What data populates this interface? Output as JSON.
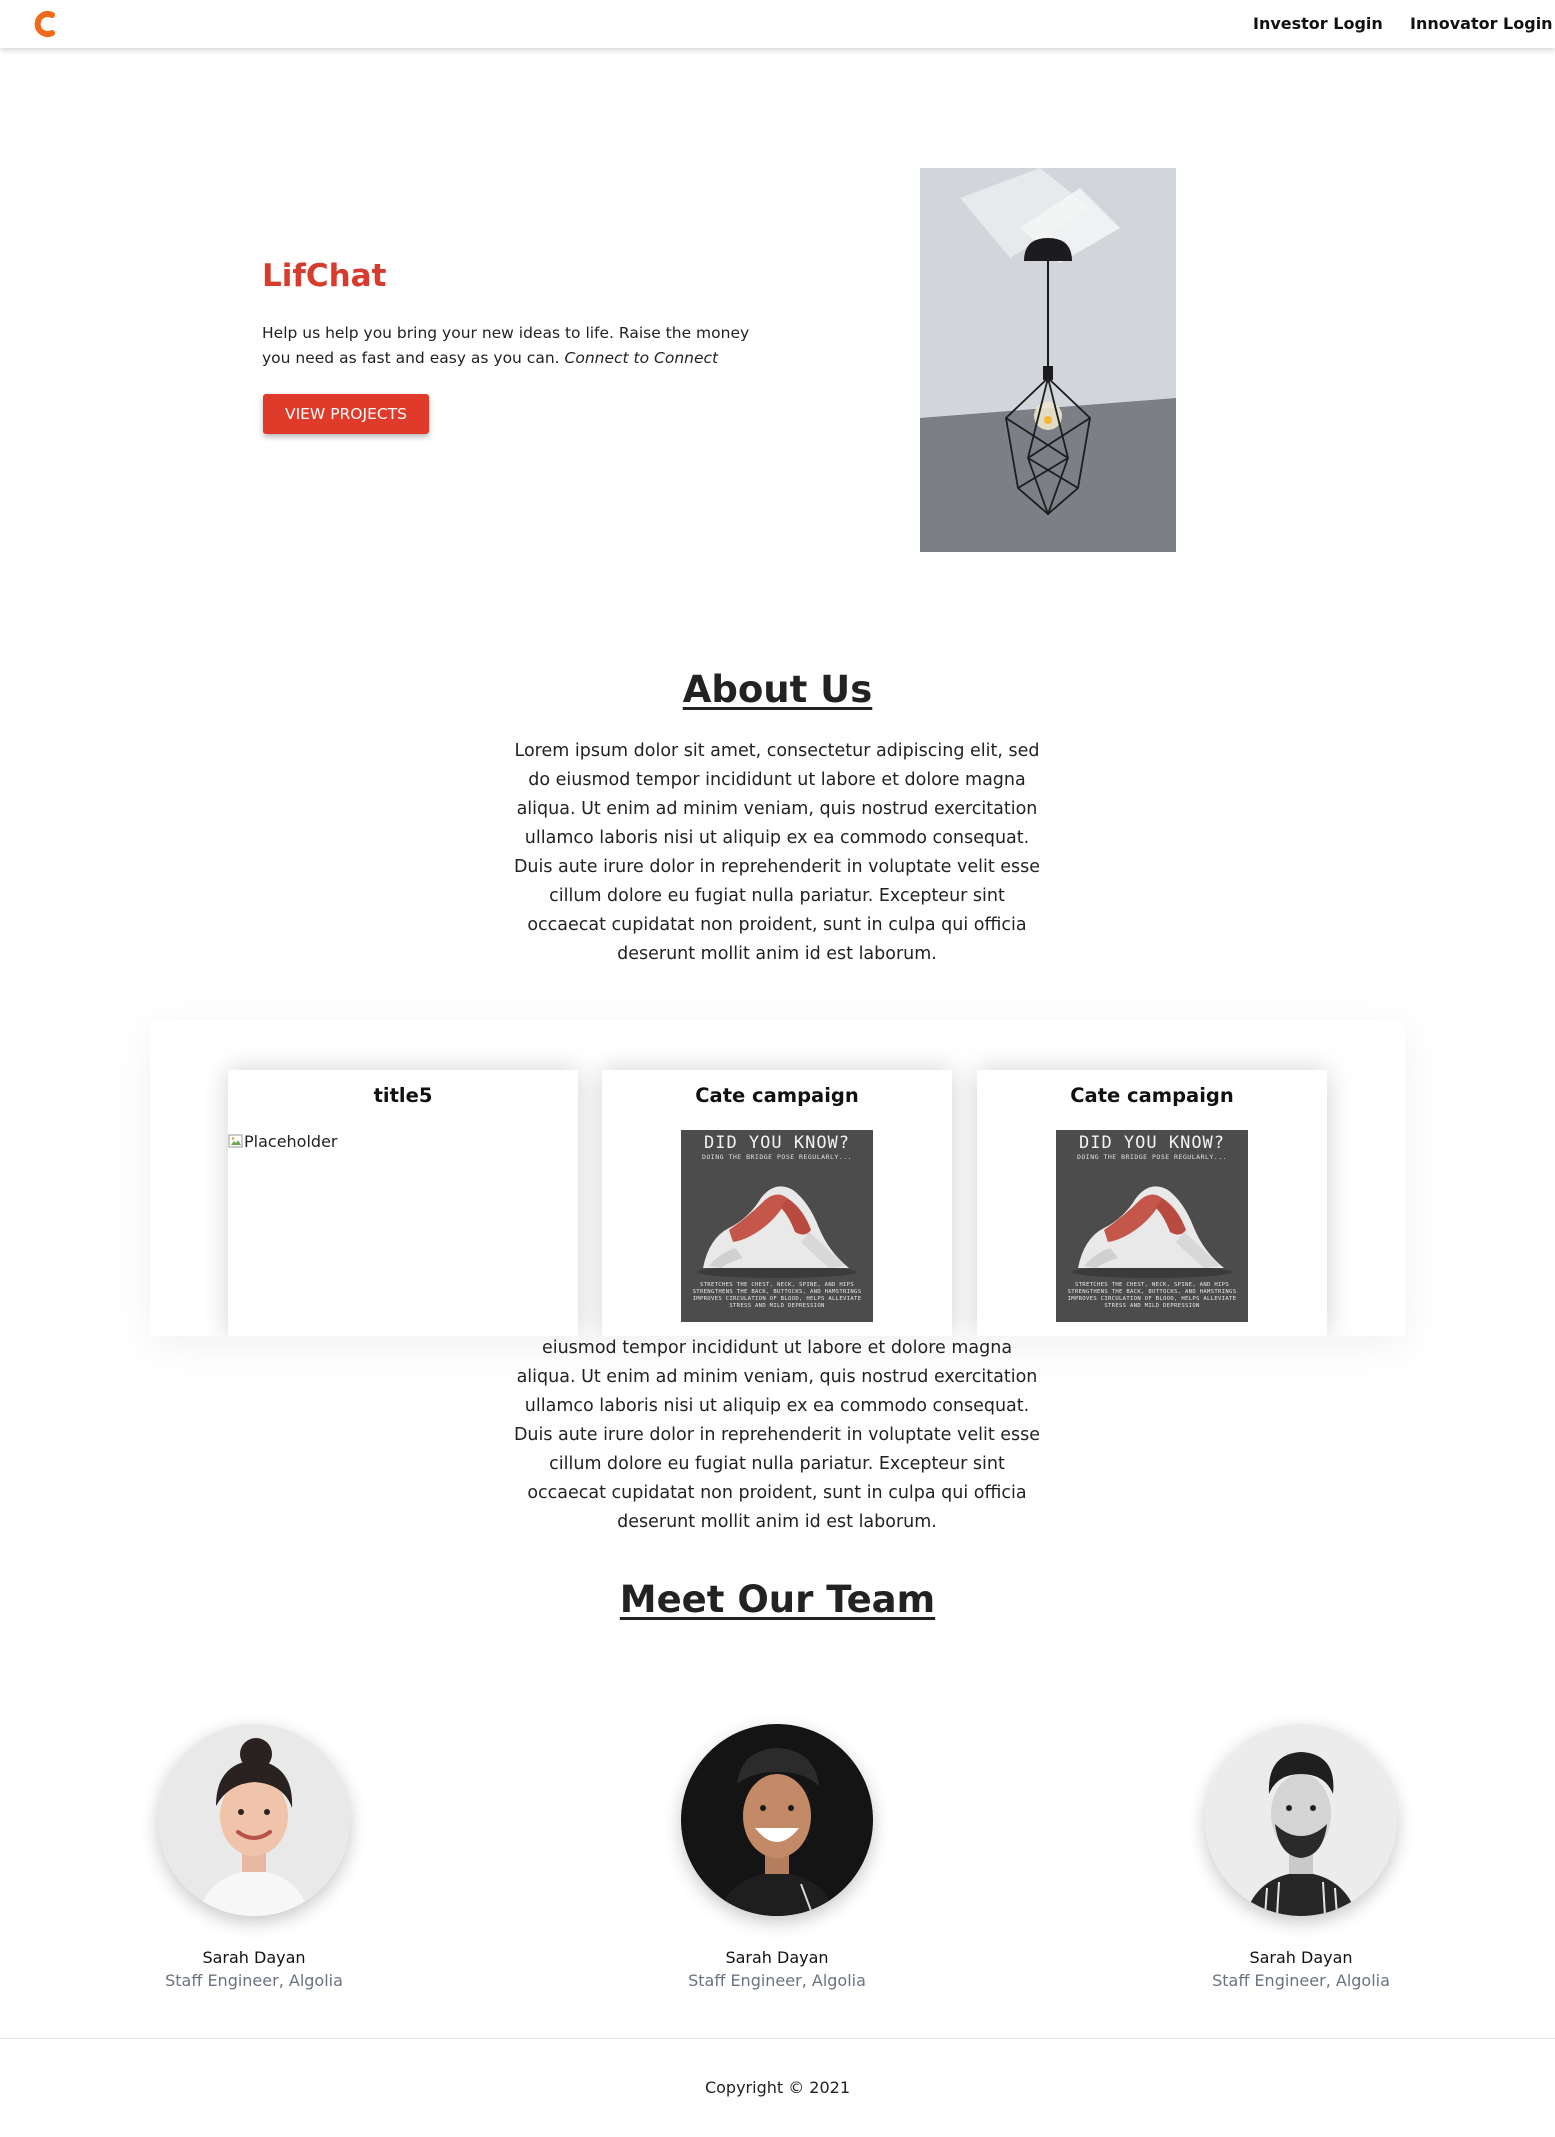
{
  "header": {
    "logo_icon": "brand-c-logo-icon",
    "investor_login": "Investor Login",
    "innovator_login": "Innovator Login"
  },
  "hero": {
    "title": "LifChat",
    "text": "Help us help you bring your new ideas to life. Raise the money you need as fast and easy as you can.",
    "tagline": "Connect to Connect",
    "button_label": "VIEW PROJECTS",
    "accent_color": "#e03a2a"
  },
  "about": {
    "heading": "About Us",
    "text": "Lorem ipsum dolor sit amet, consectetur adipiscing elit, sed do eiusmod tempor incididunt ut labore et dolore magna aliqua. Ut enim ad minim veniam, quis nostrud exercitation ullamco laboris nisi ut aliquip ex ea commodo consequat. Duis aute irure dolor in reprehenderit in voluptate velit esse cillum dolore eu fugiat nulla pariatur. Excepteur sint occaecat cupidatat non proident, sunt in culpa qui officia deserunt mollit anim id est laborum.",
    "text_repeat": "eiusmod tempor incididunt ut labore et dolore magna aliqua. Ut enim ad minim veniam, quis nostrud exercitation ullamco laboris nisi ut aliquip ex ea commodo consequat. Duis aute irure dolor in reprehenderit in voluptate velit esse cillum dolore eu fugiat nulla pariatur. Excepteur sint occaecat cupidatat non proident, sunt in culpa qui officia deserunt mollit anim id est laborum."
  },
  "cards": [
    {
      "title": "title5",
      "image_alt": "Placeholder"
    },
    {
      "title": "Cate campaign",
      "poster": {
        "heading": "DID YOU KNOW?",
        "sub": "DOING THE BRIDGE POSE REGULARLY...",
        "foot": "STRETCHES THE CHEST, NECK, SPINE, AND HIPS STRENGTHENS THE BACK, BUTTOCKS, AND HAMSTRINGS IMPROVES CIRCULATION OF BLOOD, HELPS ALLEVIATE STRESS AND MILD DEPRESSION"
      }
    },
    {
      "title": "Cate campaign",
      "poster": {
        "heading": "DID YOU KNOW?",
        "sub": "DOING THE BRIDGE POSE REGULARLY...",
        "foot": "STRETCHES THE CHEST, NECK, SPINE, AND HIPS STRENGTHENS THE BACK, BUTTOCKS, AND HAMSTRINGS IMPROVES CIRCULATION OF BLOOD, HELPS ALLEVIATE STRESS AND MILD DEPRESSION"
      }
    }
  ],
  "team": {
    "heading": "Meet Our Team",
    "members": [
      {
        "name": "Sarah Dayan",
        "role": "Staff Engineer, Algolia"
      },
      {
        "name": "Sarah Dayan",
        "role": "Staff Engineer, Algolia"
      },
      {
        "name": "Sarah Dayan",
        "role": "Staff Engineer, Algolia"
      }
    ]
  },
  "footer": {
    "copyright": "Copyright © 2021"
  }
}
